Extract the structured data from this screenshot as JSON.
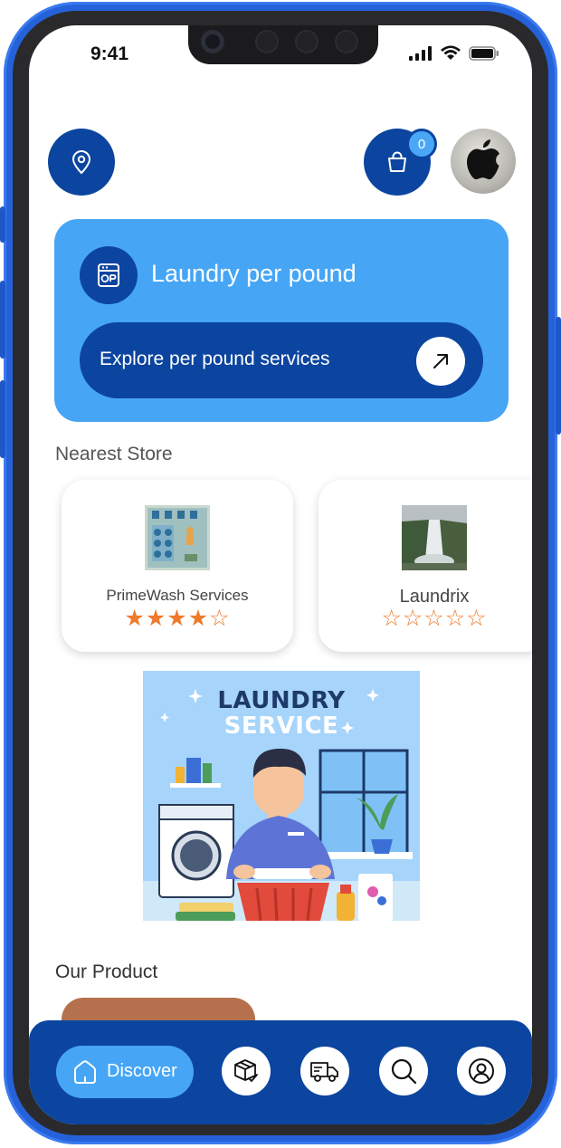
{
  "status_bar": {
    "time": "9:41"
  },
  "header": {
    "location_icon": "location-pin-icon",
    "cart_icon": "shopping-bag-icon",
    "cart_count": "0",
    "avatar_icon": "apple-logo-icon"
  },
  "promo": {
    "icon": "washing-machine-icon",
    "title": "Laundry per pound",
    "button_label": "Explore per pound services",
    "button_icon": "arrow-up-right-icon"
  },
  "nearest_store": {
    "title": "Nearest Store",
    "stores": [
      {
        "name": "PrimeWash Services",
        "rating": "★★★★☆",
        "rating_value": 4,
        "rating_max": 5
      },
      {
        "name": "Laundrix",
        "rating": "☆☆☆☆☆",
        "rating_value": 0,
        "rating_max": 5
      }
    ]
  },
  "banner": {
    "line1": "LAUNDRY",
    "line2": "SERVICE"
  },
  "products": {
    "title": "Our Product"
  },
  "bottom_nav": {
    "discover_label": "Discover",
    "items": [
      "home-icon",
      "package-check-icon",
      "delivery-truck-icon",
      "search-icon",
      "user-profile-icon"
    ]
  },
  "colors": {
    "primary_blue": "#0c45a0",
    "light_blue": "#46a6f5",
    "star_orange": "#ee7a2c",
    "frame_blue": "#2561d9"
  }
}
